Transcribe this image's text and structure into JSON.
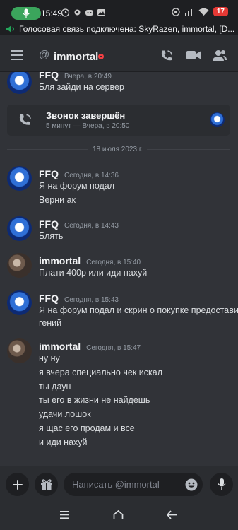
{
  "status_bar": {
    "time": "15:49",
    "battery": "17"
  },
  "voice_banner": {
    "text": "Голосовая связь подключена: SkyRazen, immortal, [D..."
  },
  "header": {
    "at_symbol": "@",
    "channel_name": "immortal"
  },
  "call_card": {
    "title": "Звонок завершён",
    "subtitle": "5 минут — Вчера, в 20:50"
  },
  "date_divider": "18 июля 2023 г.",
  "messages": [
    {
      "author": "FFQ",
      "timestamp": "Вчера, в 20:49",
      "lines": [
        "Бля зайди на сервер"
      ]
    },
    {
      "author": "FFQ",
      "timestamp": "Сегодня, в 14:36",
      "lines": [
        "Я на форум подал",
        "Верни ак"
      ]
    },
    {
      "author": "FFQ",
      "timestamp": "Сегодня, в 14:43",
      "lines": [
        "Блять"
      ]
    },
    {
      "author": "immortal",
      "timestamp": "Сегодня, в 15:40",
      "lines": [
        "Плати 400р или иди нахуй"
      ]
    },
    {
      "author": "FFQ",
      "timestamp": "Сегодня, в 15:43",
      "lines": [
        "Я на форум подал и скрин о покупке предоставил",
        "гений"
      ]
    },
    {
      "author": "immortal",
      "timestamp": "Сегодня, в 15:47",
      "lines": [
        "ну ну",
        "я вчера специально чек искал",
        "ты даун",
        "ты его в жизни не найдешь",
        "удачи лошок",
        "я щас его продам и все",
        "и иди нахуй"
      ]
    }
  ],
  "composer": {
    "placeholder": "Написать @immortal"
  },
  "colors": {
    "background": "#313338",
    "header": "#2b2d31",
    "voice_green": "#3ba55c",
    "dnd_red": "#f23f43"
  },
  "icons": [
    "microphone-icon",
    "hamburger-icon",
    "phone-icon",
    "video-icon",
    "members-icon",
    "plus-icon",
    "gift-icon",
    "emoji-icon",
    "home-icon",
    "back-icon"
  ]
}
